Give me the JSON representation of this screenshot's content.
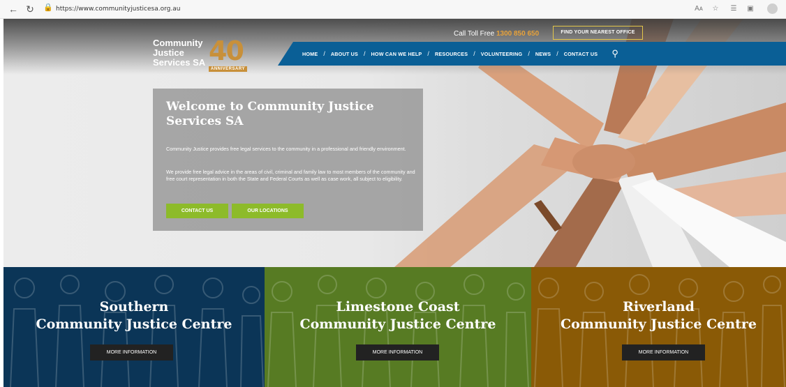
{
  "browser": {
    "url": "https://www.communityjusticesa.org.au",
    "icons": [
      "back-arrow-icon",
      "refresh-icon",
      "lock-icon",
      "read-aloud-icon",
      "favorites-star-icon",
      "collections-icon",
      "extensions-icon",
      "profile-avatar-icon"
    ],
    "read_aloud_label": "Aᴀ"
  },
  "header": {
    "logo": {
      "line1": "Community",
      "line2": "Justice",
      "line3": "Services SA",
      "badge_number": "40",
      "badge_text": "ANNIVERSARY"
    },
    "toll_free_label": "Call Toll Free",
    "toll_free_number": "1300 850 650",
    "nearest_office_button": "FIND YOUR NEAREST OFFICE",
    "nav": [
      "HOME",
      "ABOUT US",
      "HOW CAN WE HELP",
      "RESOURCES",
      "VOLUNTEERING",
      "NEWS",
      "CONTACT US"
    ],
    "nav_separator": "/"
  },
  "hero": {
    "title": "Welcome to Community Justice Services SA",
    "paragraph1": "Community Justice provides free legal services to the community in a professional and friendly environment.",
    "paragraph2": "We provide free legal advice in the areas of civil, criminal and family law to most members of the community and free court representation in both the State and Federal Courts as well as case work, all subject to eligibility.",
    "contact_button": "CONTACT US",
    "locations_button": "OUR LOCATIONS"
  },
  "centres": [
    {
      "line1": "Southern",
      "line2": "Community Justice Centre",
      "button": "MORE INFORMATION",
      "color": "#0b3557"
    },
    {
      "line1": "Limestone Coast",
      "line2": "Community Justice Centre",
      "button": "MORE INFORMATION",
      "color": "#577b23"
    },
    {
      "line1": "Riverland",
      "line2": "Community Justice Centre",
      "button": "MORE INFORMATION",
      "color": "#8a5a06"
    }
  ],
  "colors": {
    "nav_blue": "#0a5f96",
    "button_green": "#8dbb2a",
    "gold": "#c8903a"
  }
}
